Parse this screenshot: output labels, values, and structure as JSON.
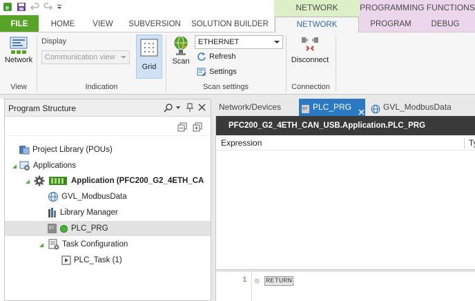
{
  "titlebar": {
    "quick_access": [
      "app-icon",
      "save-icon",
      "undo-icon",
      "redo-icon",
      "customize-icon"
    ],
    "context_groups": {
      "network": "NETWORK FUNCTIONS",
      "programming": "PROGRAMMING FUNCTIONS"
    }
  },
  "tabs": {
    "file": "FILE",
    "home": "HOME",
    "view": "VIEW",
    "subversion": "SUBVERSION",
    "solution_builder": "SOLUTION BUILDER",
    "network": "NETWORK",
    "program": "PROGRAM",
    "debug": "DEBUG"
  },
  "ribbon": {
    "view_group": {
      "label": "View",
      "network_button": "Network"
    },
    "indication_group": {
      "label": "Indication",
      "display_label": "Display",
      "display_value": "Communication view",
      "grid_button": "Grid"
    },
    "scan_group": {
      "label": "Scan settings",
      "scan_button": "Scan",
      "interface_value": "ETHERNET",
      "refresh_button": "Refresh",
      "settings_button": "Settings"
    },
    "connection_group": {
      "label": "Connection",
      "disconnect_button": "Disconnect"
    }
  },
  "program_structure": {
    "title": "Program Structure",
    "tree": [
      {
        "label": "Project Library (POUs)",
        "icon": "library-icon"
      },
      {
        "label": "Applications",
        "icon": "applications-icon"
      },
      {
        "label": "Application (PFC200_G2_4ETH_CA",
        "icon": "application-icon"
      },
      {
        "label": "GVL_ModbusData",
        "icon": "globe-icon"
      },
      {
        "label": "Library Manager",
        "icon": "library-manager-icon"
      },
      {
        "label": "PLC_PRG",
        "icon": "st-program-icon"
      },
      {
        "label": "Task Configuration",
        "icon": "task-config-icon"
      },
      {
        "label": "PLC_Task (1)",
        "icon": "task-icon"
      }
    ]
  },
  "doc_tabs": {
    "network_devices": "Network/Devices",
    "plc_prg": "PLC_PRG",
    "gvl": "GVL_ModbusData"
  },
  "editor": {
    "header": "PFC200_G2_4ETH_CAN_USB.Application.PLC_PRG",
    "col_expression": "Expression",
    "col_type": "Ty",
    "line_number": "1",
    "code": "RETURN"
  },
  "colors": {
    "file_tab": "#58a429",
    "network_context": "#dcefc6",
    "programming_context": "#ecd6ec",
    "active_doc_tab": "#2b79c2",
    "editor_header": "#3a3a3a",
    "selected_row": "#e2e2e2"
  }
}
